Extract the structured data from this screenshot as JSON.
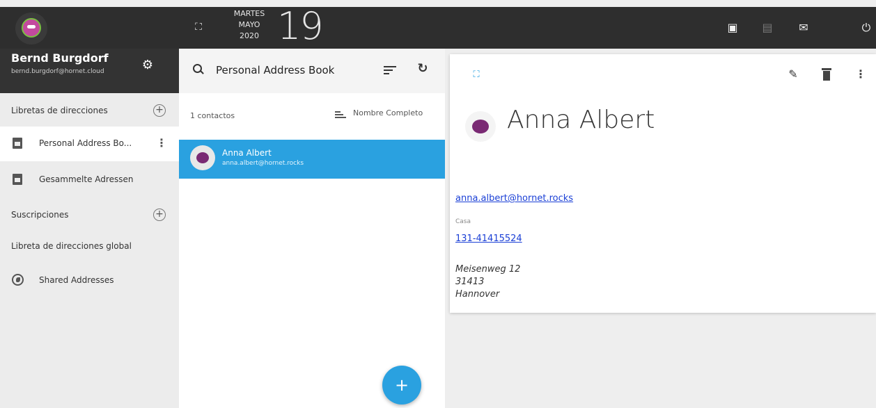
{
  "topbar": {
    "weekday": "MARTES",
    "month": "MAYO",
    "year": "2020",
    "day": "19"
  },
  "user": {
    "name": "Bernd Burgdorf",
    "email": "bernd.burgdorf@hornet.cloud"
  },
  "sidebar": {
    "address_books_heading": "Libretas de direcciones",
    "items": [
      {
        "label": "Personal Address Bo..."
      },
      {
        "label": "Gesammelte Adressen"
      }
    ],
    "subscriptions_heading": "Suscripciones",
    "global_heading": "Libreta de direcciones global",
    "shared_label": "Shared Addresses"
  },
  "list": {
    "title": "Personal Address Book",
    "count": "1 contactos",
    "sort_field": "Nombre Completo",
    "contacts": [
      {
        "name": "Anna Albert",
        "email": "anna.albert@hornet.rocks"
      }
    ],
    "add_label": "+"
  },
  "detail": {
    "name": "Anna Albert",
    "email": "anna.albert@hornet.rocks",
    "phone_label": "Casa",
    "phone": "131-41415524",
    "address_line1": "Meisenweg 12",
    "address_line2": "31413",
    "address_line3": "Hannover"
  },
  "colors": {
    "accent": "#2aa1e0",
    "topbar": "#2e2e2e",
    "link": "#1a3fd6"
  }
}
